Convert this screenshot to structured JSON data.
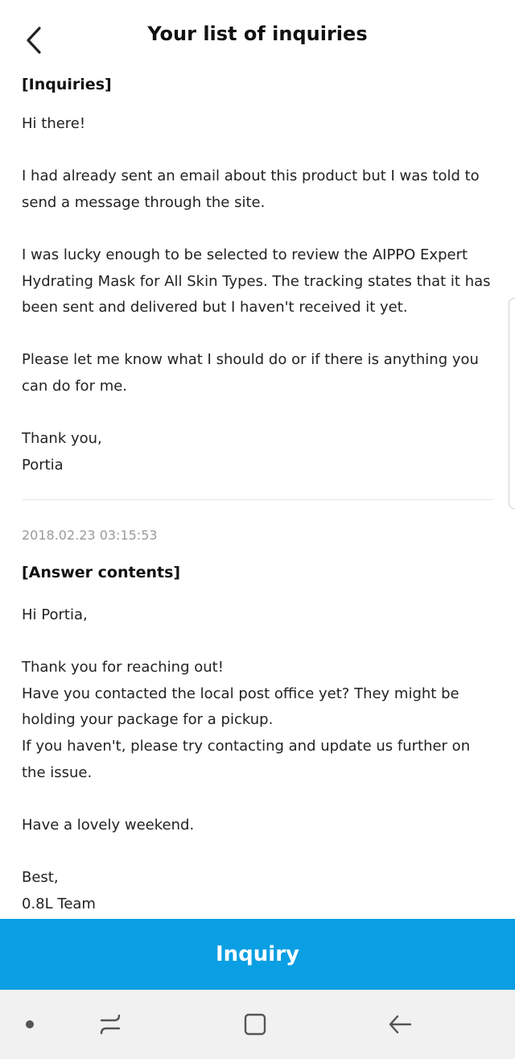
{
  "header": {
    "title": "Your list of inquiries",
    "back_icon": "chevron-left-icon"
  },
  "inquiry": {
    "label": "[Inquiries]",
    "body": "Hi there!\n\nI had already sent an email about this product but I was told to send a message through the site.\n\nI was lucky enough to be selected to review the AIPPO Expert Hydrating Mask for All Skin Types. The tracking states that it has been sent and delivered but I haven't received it yet.\n\nPlease let me know what I should do or if there is anything you can do for me.\n\nThank you,\nPortia"
  },
  "answer": {
    "timestamp": "2018.02.23 03:15:53",
    "label": "[Answer contents]",
    "body": "Hi Portia,\n\nThank you for reaching out!\nHave you contacted the local post office yet? They might be holding your package for a pickup.\nIf you haven't, please try contacting and update us further on the issue.\n\nHave a lovely weekend.\n\nBest,\n0.8L Team"
  },
  "footer": {
    "inquiry_button_label": "Inquiry"
  },
  "colors": {
    "accent": "#0a9fe3",
    "timestamp": "#9a9a9a",
    "navbar": "#f1f1f1"
  },
  "navbar": {
    "icons": [
      "dot-icon",
      "recent-apps-icon",
      "home-icon",
      "back-arrow-icon"
    ]
  }
}
